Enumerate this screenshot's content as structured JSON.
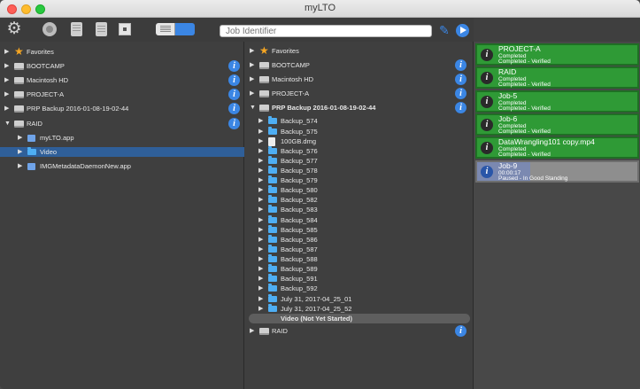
{
  "window": {
    "title": "myLTO"
  },
  "toolbar": {
    "job_identifier_placeholder": "Job Identifier",
    "icons": [
      "gear-icon",
      "circle-icon",
      "document-icon",
      "calendar-icon",
      "box-icon",
      "segmented-control",
      "pencil-icon",
      "play-icon"
    ],
    "accent_color": "#3b86e4"
  },
  "left_pane": {
    "items": [
      {
        "label": "Favorites",
        "icon": "star-icon",
        "disclosure": "collapsed"
      },
      {
        "label": "BOOTCAMP",
        "icon": "drive-icon",
        "disclosure": "collapsed",
        "info": true
      },
      {
        "label": "Macintosh HD",
        "icon": "drive-icon",
        "disclosure": "collapsed",
        "info": true
      },
      {
        "label": "PROJECT-A",
        "icon": "drive-icon",
        "disclosure": "collapsed",
        "info": true
      },
      {
        "label": "PRP Backup 2016-01-08-19-02-44",
        "icon": "drive-icon",
        "disclosure": "collapsed",
        "info": true
      },
      {
        "label": "RAID",
        "icon": "drive-icon",
        "disclosure": "expanded",
        "info": true
      },
      {
        "label": "myLTO.app",
        "icon": "app-icon",
        "disclosure": "collapsed"
      },
      {
        "label": "Video",
        "icon": "folder-icon",
        "disclosure": "collapsed",
        "selected": true
      },
      {
        "label": "IMGMetadataDaemonNew.app",
        "icon": "app-icon",
        "disclosure": "collapsed"
      }
    ]
  },
  "middle_pane": {
    "top_items": [
      {
        "label": "Favorites",
        "icon": "star-icon",
        "disclosure": "collapsed"
      },
      {
        "label": "BOOTCAMP",
        "icon": "drive-icon",
        "disclosure": "collapsed",
        "info": true
      },
      {
        "label": "Macintosh HD",
        "icon": "drive-icon",
        "disclosure": "collapsed",
        "info": true
      },
      {
        "label": "PROJECT-A",
        "icon": "drive-icon",
        "disclosure": "collapsed",
        "info": true
      },
      {
        "label": "PRP Backup 2016-01-08-19-02-44",
        "icon": "drive-icon",
        "disclosure": "expanded",
        "info": true,
        "bold": true
      }
    ],
    "children": [
      {
        "label": "Backup_574",
        "icon": "folder-icon"
      },
      {
        "label": "Backup_575",
        "icon": "folder-icon"
      },
      {
        "label": "100GB.dmg",
        "icon": "file-icon"
      },
      {
        "label": "Backup_576",
        "icon": "folder-icon"
      },
      {
        "label": "Backup_577",
        "icon": "folder-icon"
      },
      {
        "label": "Backup_578",
        "icon": "folder-icon"
      },
      {
        "label": "Backup_579",
        "icon": "folder-icon"
      },
      {
        "label": "Backup_580",
        "icon": "folder-icon"
      },
      {
        "label": "Backup_582",
        "icon": "folder-icon"
      },
      {
        "label": "Backup_583",
        "icon": "folder-icon"
      },
      {
        "label": "Backup_584",
        "icon": "folder-icon"
      },
      {
        "label": "Backup_585",
        "icon": "folder-icon"
      },
      {
        "label": "Backup_586",
        "icon": "folder-icon"
      },
      {
        "label": "Backup_587",
        "icon": "folder-icon"
      },
      {
        "label": "Backup_588",
        "icon": "folder-icon"
      },
      {
        "label": "Backup_589",
        "icon": "folder-icon"
      },
      {
        "label": "Backup_591",
        "icon": "folder-icon"
      },
      {
        "label": "Backup_592",
        "icon": "folder-icon"
      },
      {
        "label": "July 31, 2017-04_25_01",
        "icon": "folder-icon"
      },
      {
        "label": "July 31, 2017-04_25_52",
        "icon": "folder-icon"
      },
      {
        "label": "Video (Not Yet Started)",
        "icon": "none",
        "bold": true,
        "highlighted": true
      }
    ],
    "bottom_items": [
      {
        "label": "RAID",
        "icon": "drive-icon",
        "disclosure": "collapsed",
        "info": true
      }
    ]
  },
  "jobs": [
    {
      "name": "PROJECT-A",
      "status1": "Completed",
      "status2": "Completed - Verified",
      "state": "completed"
    },
    {
      "name": "RAID",
      "status1": "Completed",
      "status2": "Completed - Verified",
      "state": "completed"
    },
    {
      "name": "Job-5",
      "status1": "Completed",
      "status2": "Completed - Verified",
      "state": "completed"
    },
    {
      "name": "Job-6",
      "status1": "Completed",
      "status2": "Completed - Verified",
      "state": "completed"
    },
    {
      "name": "DataWrangling101 copy.mp4",
      "status1": "Completed",
      "status2": "Completed - Verified",
      "state": "completed"
    },
    {
      "name": "Job-9",
      "status1": "00:00:17",
      "status2": "Paused - In Good Standing",
      "state": "paused"
    }
  ],
  "colors": {
    "completed": "#2f9a36",
    "paused": "#8e8e8e",
    "selection": "#2f5f99"
  }
}
